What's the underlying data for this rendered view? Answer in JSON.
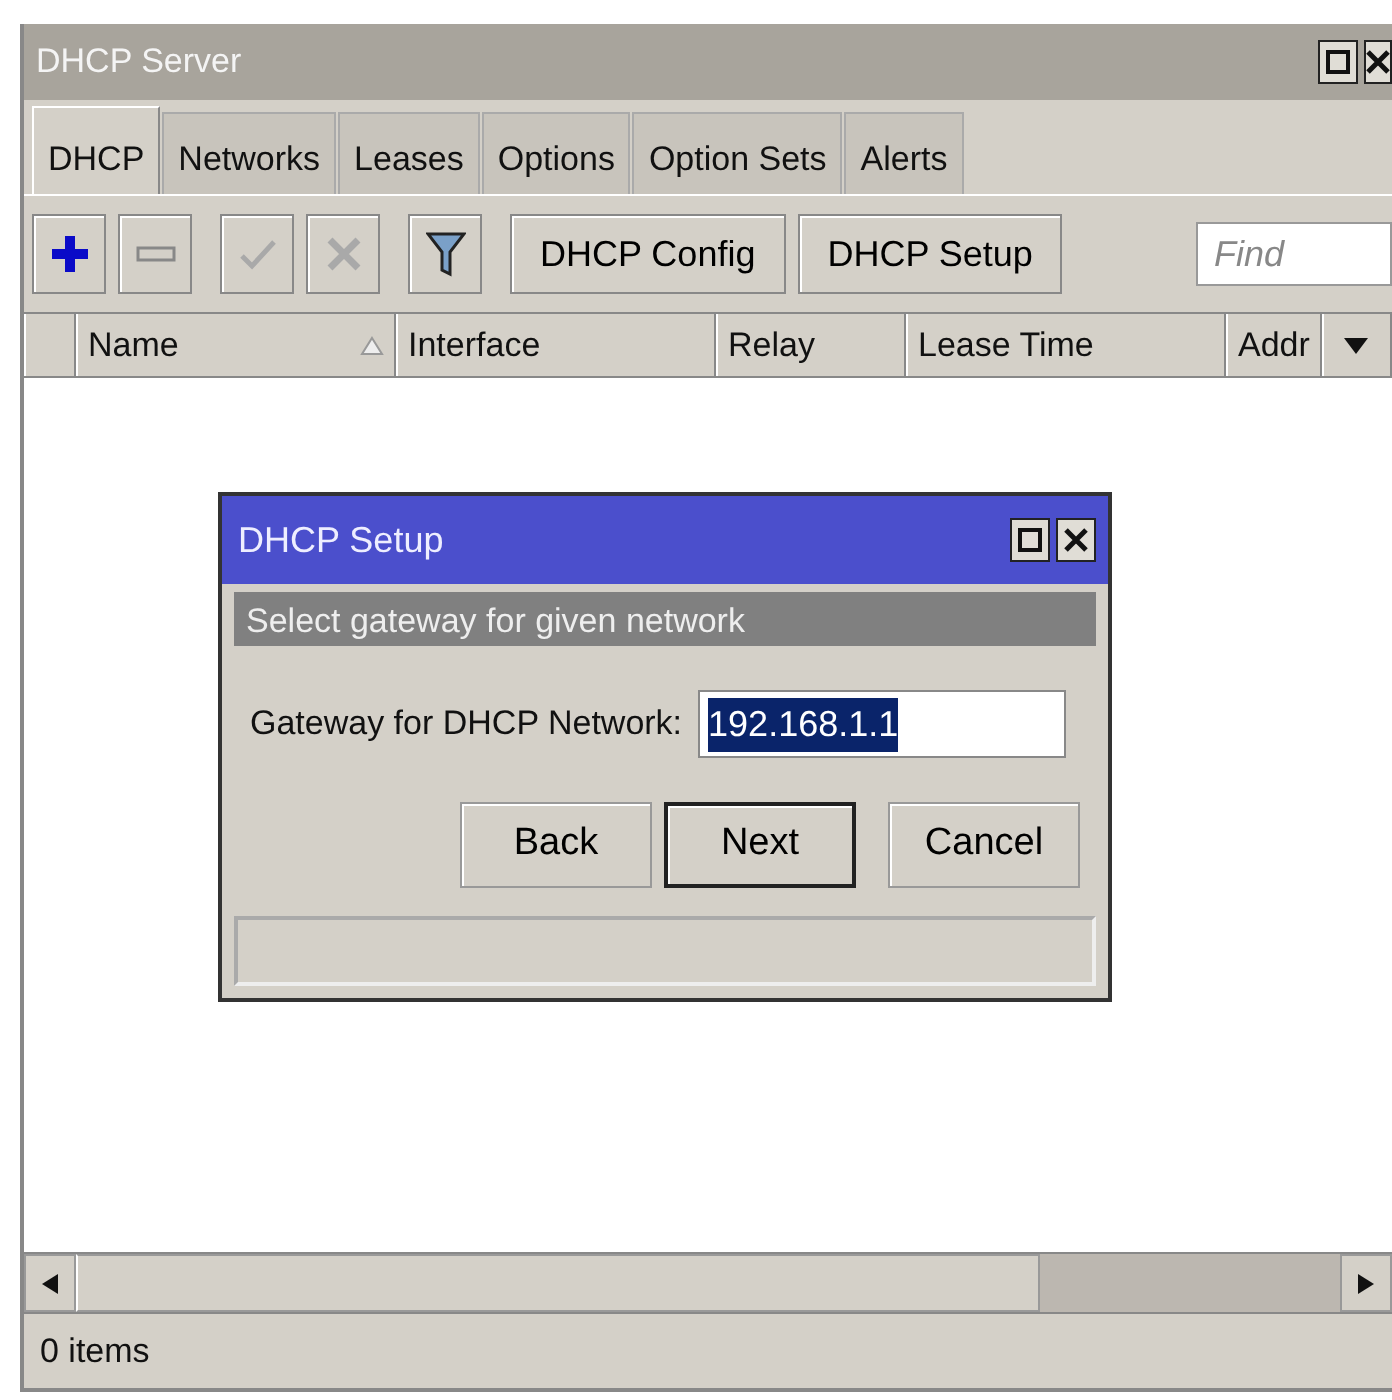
{
  "window": {
    "title": "DHCP Server"
  },
  "tabs": [
    {
      "label": "DHCP",
      "selected": true
    },
    {
      "label": "Networks",
      "selected": false
    },
    {
      "label": "Leases",
      "selected": false
    },
    {
      "label": "Options",
      "selected": false
    },
    {
      "label": "Option Sets",
      "selected": false
    },
    {
      "label": "Alerts",
      "selected": false
    }
  ],
  "toolbar": {
    "buttons": [
      {
        "kind": "add",
        "disabled": false
      },
      {
        "kind": "remove",
        "disabled": false
      },
      {
        "kind": "enable",
        "disabled": true
      },
      {
        "kind": "disable",
        "disabled": true
      },
      {
        "kind": "filter",
        "disabled": false
      },
      {
        "kind": "text",
        "label": "DHCP Config",
        "disabled": false
      },
      {
        "kind": "text",
        "label": "DHCP Setup",
        "disabled": false
      }
    ],
    "find": {
      "placeholder": "Find"
    }
  },
  "table": {
    "columns": [
      {
        "label": "Name",
        "sorted": true
      },
      {
        "label": "Interface",
        "sorted": false
      },
      {
        "label": "Relay",
        "sorted": false
      },
      {
        "label": "Lease Time",
        "sorted": false
      },
      {
        "label": "Addr",
        "sorted": false
      }
    ]
  },
  "status_bar": "0 items",
  "dialog": {
    "title": "DHCP Setup",
    "prompt": "Select gateway for given network",
    "field": {
      "label": "Gateway for DHCP Network:",
      "value": "192.168.1.1",
      "text_selected": true
    },
    "buttons": [
      {
        "label": "Back",
        "default": false
      },
      {
        "label": "Next",
        "default": true
      },
      {
        "label": "Cancel",
        "default": false
      }
    ]
  }
}
